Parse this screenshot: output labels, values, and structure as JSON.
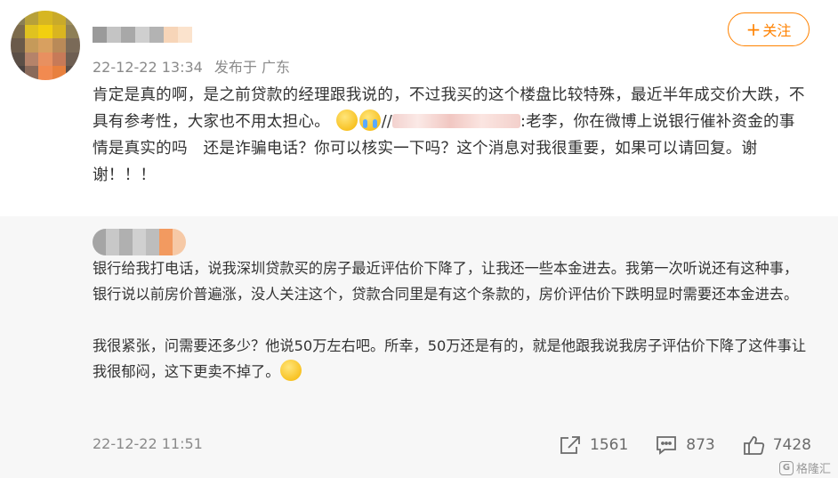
{
  "post": {
    "timestamp": "22-12-22 13:34",
    "source": "发布于 广东",
    "follow_label": "关注",
    "follow_icon": "plus-icon",
    "text_part1": "肯定是真的啊，是之前贷款的经理跟我说的，不过我买的这个楼盘比较特殊，最近半年成交价大跌，不具有参考性，大家也不用太担心。",
    "emojis": [
      "thinking-face-emoji",
      "crying-face-emoji"
    ],
    "separator": "//",
    "text_part2": ":老李，你在微博上说银行催补资金的事情是真实的吗　还是诈骗电话？你可以核实一下吗？这个消息对我很重要，如果可以请回复。谢谢！！！"
  },
  "repost": {
    "paragraph1": "银行给我打电话，说我深圳贷款买的房子最近评估价下降了，让我还一些本金进去。我第一次听说还有这种事，银行说以前房价普遍涨，没人关注这个，贷款合同里是有这个条款的，房价评估价下跌明显时需要还本金进去。",
    "paragraph2": "我很紧张，问需要还多少？他说50万左右吧。所幸，50万还是有的，就是他跟我说我房子评估价下降了这件事让我很郁闷，这下更卖不掉了。",
    "paragraph2_emoji": "thinking-face-emoji",
    "timestamp": "22-12-22 11:51",
    "actions": {
      "repost_count": "1561",
      "comment_count": "873",
      "like_count": "7428"
    }
  },
  "watermark": {
    "text": "格隆汇",
    "icon_letter": "G"
  },
  "colors": {
    "accent": "#ff8200",
    "meta_gray": "#8a8a8a",
    "repost_bg": "#f7f7f7"
  }
}
